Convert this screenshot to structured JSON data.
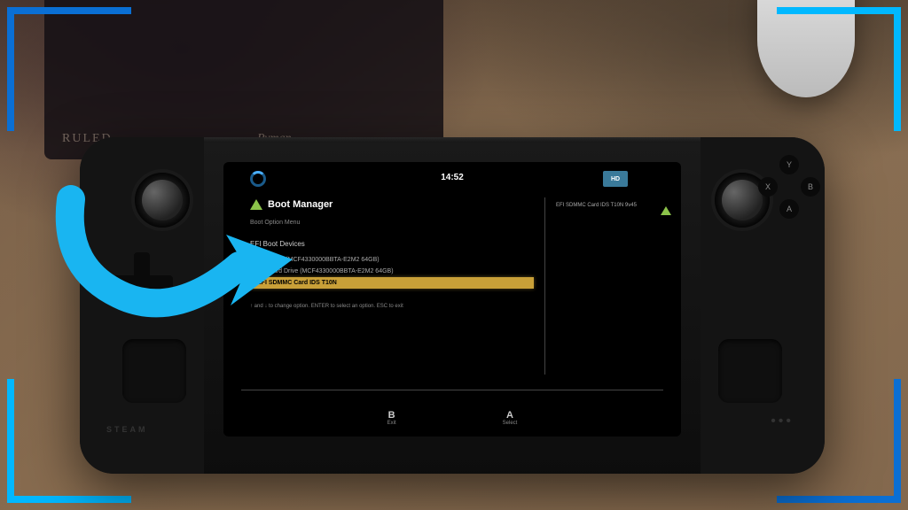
{
  "clock": "14:52",
  "brand_logo": "HD",
  "boot_manager": {
    "title": "Boot Manager",
    "subtitle": "Boot Option Menu",
    "section_label": "EFI Boot Devices",
    "items": [
      {
        "label": "SteamOS (MCF4330000BBTA-E2M2 64GB)",
        "selected": false
      },
      {
        "label": "EFI Hard Drive (MCF4330000BBTA-E2M2 64GB)",
        "selected": false
      },
      {
        "label": "EFI SDMMC Card IDS T10N",
        "selected": true
      }
    ],
    "right_panel": "EFI SDMMC Card IDS T10N 9v45",
    "help_text": "↑ and ↓ to change option. ENTER to select an option. ESC to exit"
  },
  "bottom_buttons": [
    {
      "key": "B",
      "label": "Exit"
    },
    {
      "key": "A",
      "label": "Select"
    }
  ],
  "hardware": {
    "left_label": "STEAM",
    "face_buttons": {
      "y": "Y",
      "x": "X",
      "b": "B",
      "a": "A"
    }
  },
  "background_labels": {
    "book1": "RULED",
    "book2": "Ryman"
  },
  "accent_colors": {
    "frame_dark": "#0a6fd4",
    "frame_light": "#00b8ff",
    "arrow": "#19b5f1",
    "highlight": "#c9a038"
  }
}
